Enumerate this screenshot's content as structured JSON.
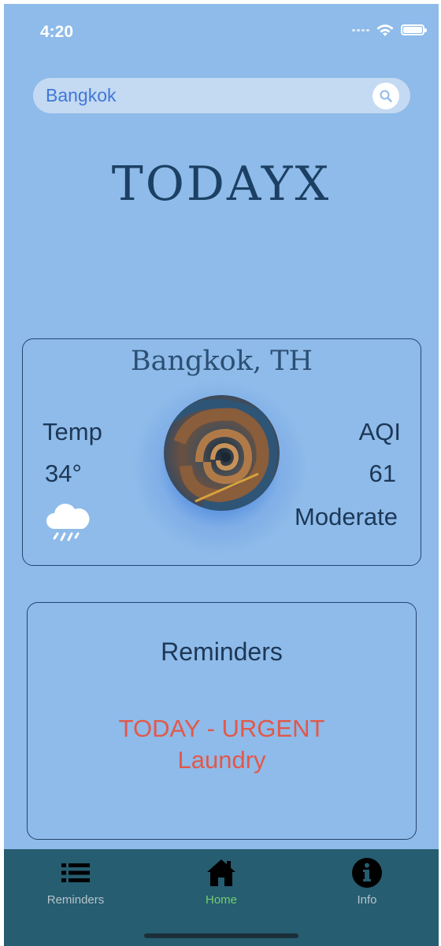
{
  "status_bar": {
    "time": "4:20"
  },
  "search": {
    "value": "Bangkok"
  },
  "app": {
    "logo": "TODAYX"
  },
  "weather": {
    "city": "Bangkok, TH",
    "temp_label": "Temp",
    "temp_value": "34°",
    "aqi_label": "AQI",
    "aqi_value": "61",
    "aqi_status": "Moderate",
    "condition_icon": "cloud-rain-icon"
  },
  "reminders": {
    "title": "Reminders",
    "urgent_label": "TODAY - URGENT",
    "item": "Laundry",
    "accent_color": "#e2584a"
  },
  "tabbar": {
    "tabs": [
      {
        "label": "Reminders",
        "icon": "list-icon",
        "active": false
      },
      {
        "label": "Home",
        "icon": "home-icon",
        "active": true
      },
      {
        "label": "Info",
        "icon": "info-icon",
        "active": false
      }
    ],
    "active_color": "#6fcf6a",
    "background": "#265d70"
  },
  "colors": {
    "background": "#8ebbe9",
    "text": "#1d3756"
  }
}
